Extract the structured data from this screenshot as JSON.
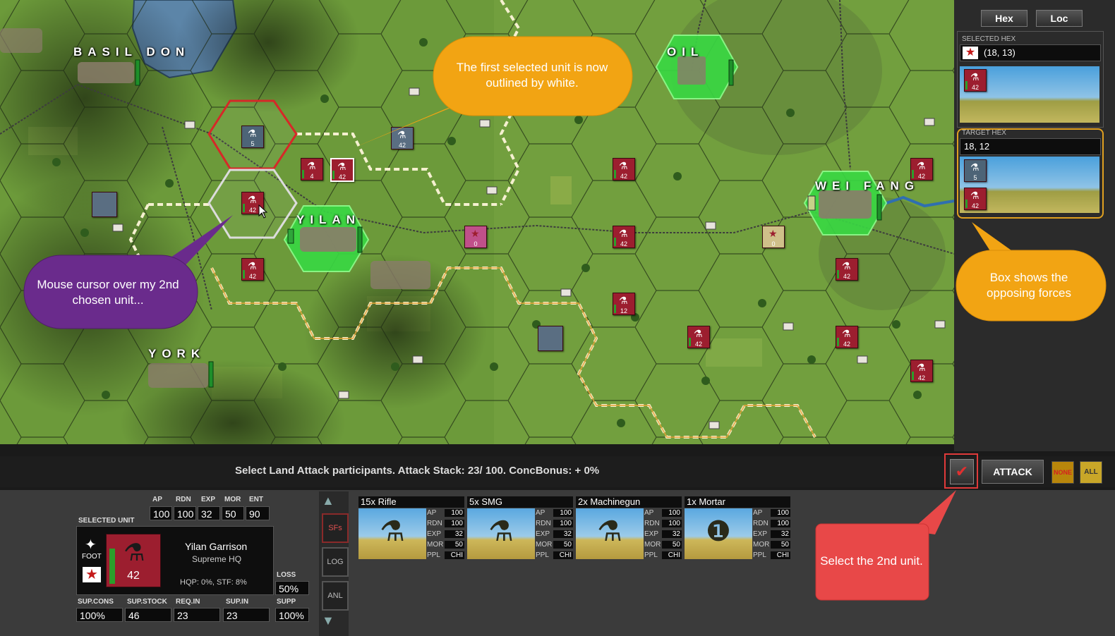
{
  "map": {
    "cities": [
      {
        "name": "BASIL DON"
      },
      {
        "name": "OIL"
      },
      {
        "name": "YILAN"
      },
      {
        "name": "WEI FANG"
      },
      {
        "name": "YORK"
      }
    ],
    "units": [
      {
        "value": "5"
      },
      {
        "value": "4"
      },
      {
        "value": "42"
      },
      {
        "value": "42"
      },
      {
        "value": "42"
      },
      {
        "value": "42"
      },
      {
        "value": "0"
      },
      {
        "value": "42"
      },
      {
        "value": "0"
      },
      {
        "value": "42"
      },
      {
        "value": "12"
      },
      {
        "value": "42"
      },
      {
        "value": "42"
      },
      {
        "value": "42"
      },
      {
        "value": "42"
      },
      {
        "value": "42"
      }
    ]
  },
  "callouts": {
    "first_unit": "The first selected unit is now outlined by white.",
    "mouse_cursor": "Mouse cursor over my 2nd chosen unit...",
    "box_shows": "Box shows the opposing forces",
    "select_2nd": "Select the 2nd unit."
  },
  "right_panel": {
    "hex_button": "Hex",
    "loc_button": "Loc",
    "selected_hex_label": "SELECTED HEX",
    "selected_hex_value": "(18, 13)",
    "selected_unit_value": "42",
    "target_hex_label": "TARGET HEX",
    "target_hex_value": "18, 12",
    "target_units": [
      {
        "value": "5"
      },
      {
        "value": "42"
      }
    ]
  },
  "status": {
    "text": "Select Land Attack participants. Attack Stack:  23/ 100. ConcBonus: + 0%",
    "attack_button": "ATTACK",
    "none_button": "NONE",
    "all_button": "ALL"
  },
  "unit_panel": {
    "selected_unit_label": "SELECTED UNIT",
    "stats": [
      {
        "label": "AP",
        "value": "100"
      },
      {
        "label": "RDN",
        "value": "100"
      },
      {
        "label": "EXP",
        "value": "32"
      },
      {
        "label": "MOR",
        "value": "50"
      },
      {
        "label": "ENT",
        "value": "90"
      }
    ],
    "foot_label": "FOOT",
    "unit_name": "Yilan Garrison",
    "unit_hq": "Supreme HQ",
    "unit_strength": "42",
    "hqp_stf": "HQP: 0%, STF: 8%",
    "loss_label": "LOSS",
    "loss_value": "50%",
    "bottom_stats": [
      {
        "label": "SUP.CONS",
        "value": "100%"
      },
      {
        "label": "SUP.STOCK",
        "value": "46"
      },
      {
        "label": "REQ.IN",
        "value": "23"
      },
      {
        "label": "SUP.IN",
        "value": "23"
      },
      {
        "label": "SUPP",
        "value": "100%"
      }
    ],
    "side_buttons": [
      "SFs",
      "LOG",
      "ANL"
    ]
  },
  "subunits": [
    {
      "title": "15x Rifle",
      "stats": [
        {
          "k": "AP",
          "v": "100"
        },
        {
          "k": "RDN",
          "v": "100"
        },
        {
          "k": "EXP",
          "v": "32"
        },
        {
          "k": "MOR",
          "v": "50"
        },
        {
          "k": "PPL",
          "v": "CHI"
        }
      ]
    },
    {
      "title": "5x SMG",
      "stats": [
        {
          "k": "AP",
          "v": "100"
        },
        {
          "k": "RDN",
          "v": "100"
        },
        {
          "k": "EXP",
          "v": "32"
        },
        {
          "k": "MOR",
          "v": "50"
        },
        {
          "k": "PPL",
          "v": "CHI"
        }
      ]
    },
    {
      "title": "2x Machinegun",
      "stats": [
        {
          "k": "AP",
          "v": "100"
        },
        {
          "k": "RDN",
          "v": "100"
        },
        {
          "k": "EXP",
          "v": "32"
        },
        {
          "k": "MOR",
          "v": "50"
        },
        {
          "k": "PPL",
          "v": "CHI"
        }
      ]
    },
    {
      "title": "1x Mortar",
      "stats": [
        {
          "k": "AP",
          "v": "100"
        },
        {
          "k": "RDN",
          "v": "100"
        },
        {
          "k": "EXP",
          "v": "32"
        },
        {
          "k": "MOR",
          "v": "50"
        },
        {
          "k": "PPL",
          "v": "CHI"
        }
      ]
    }
  ]
}
